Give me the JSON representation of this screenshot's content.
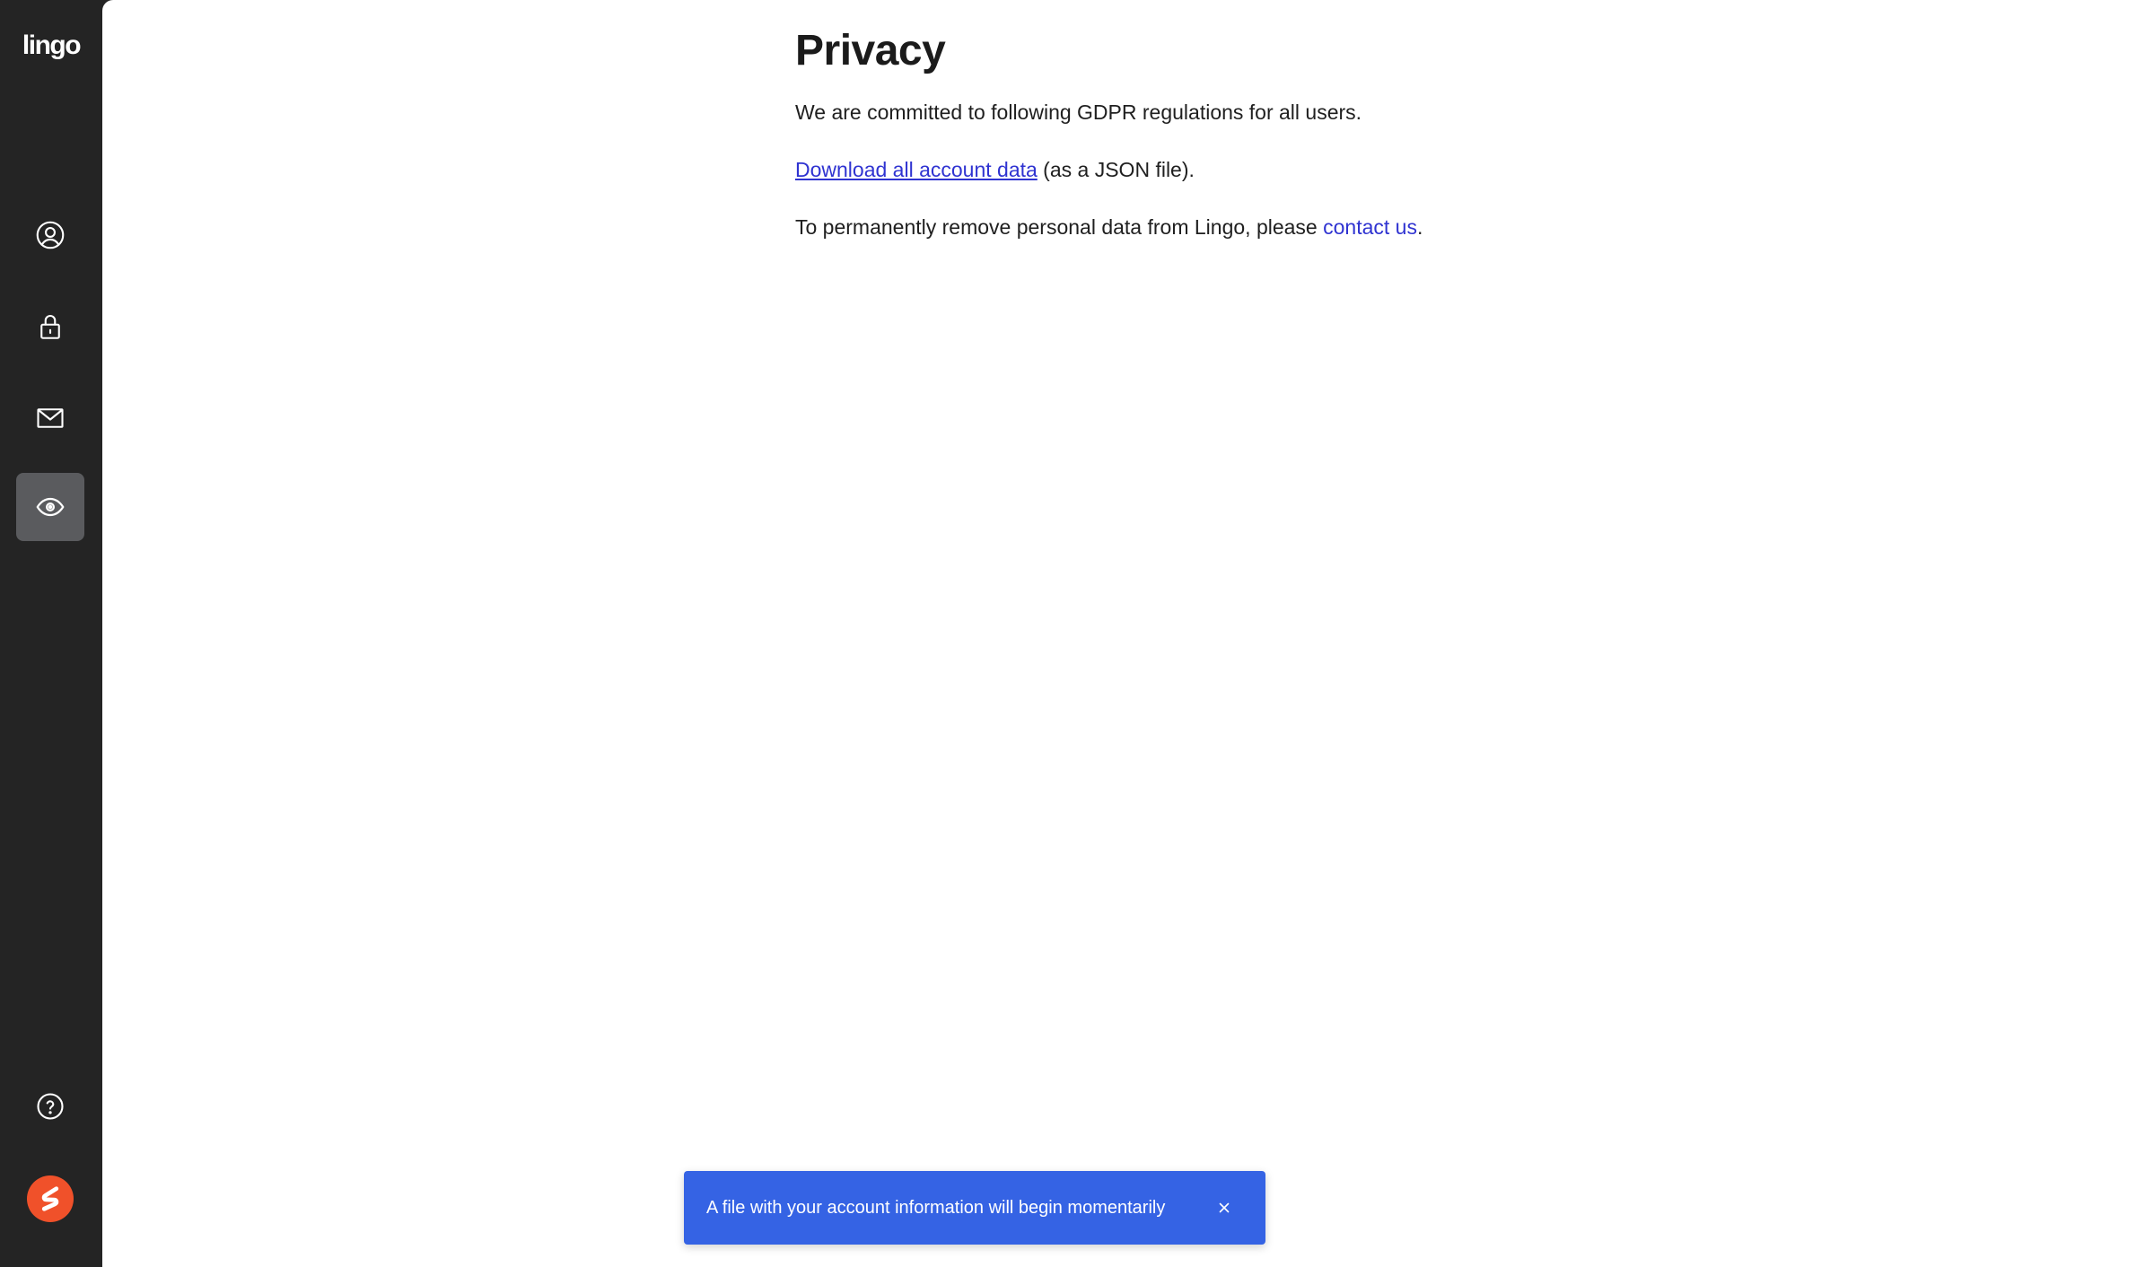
{
  "app": {
    "logo_text": "lingo",
    "brand_color": "#f0512a"
  },
  "sidebar": {
    "items": [
      {
        "name": "profile",
        "icon": "user-circle-icon",
        "active": false
      },
      {
        "name": "security",
        "icon": "lock-icon",
        "active": false
      },
      {
        "name": "email",
        "icon": "mail-icon",
        "active": false
      },
      {
        "name": "privacy",
        "icon": "eye-icon",
        "active": true
      }
    ],
    "help_icon": "help-circle-icon",
    "avatar_icon": "brand-avatar-icon"
  },
  "page": {
    "title": "Privacy",
    "intro": "We are committed to following GDPR regulations for all users.",
    "download_link": "Download all account data",
    "download_suffix": " (as a JSON file).",
    "remove_prefix": "To permanently remove personal data from Lingo, please ",
    "contact_link": "contact us",
    "remove_suffix": "."
  },
  "toast": {
    "message": "A file with your account information will begin momentarily",
    "close_icon": "close-icon",
    "color": "#3563e4"
  },
  "colors": {
    "sidebar_bg": "#242424",
    "link": "#2f33d1",
    "active_nav": "#5a5b5e"
  }
}
